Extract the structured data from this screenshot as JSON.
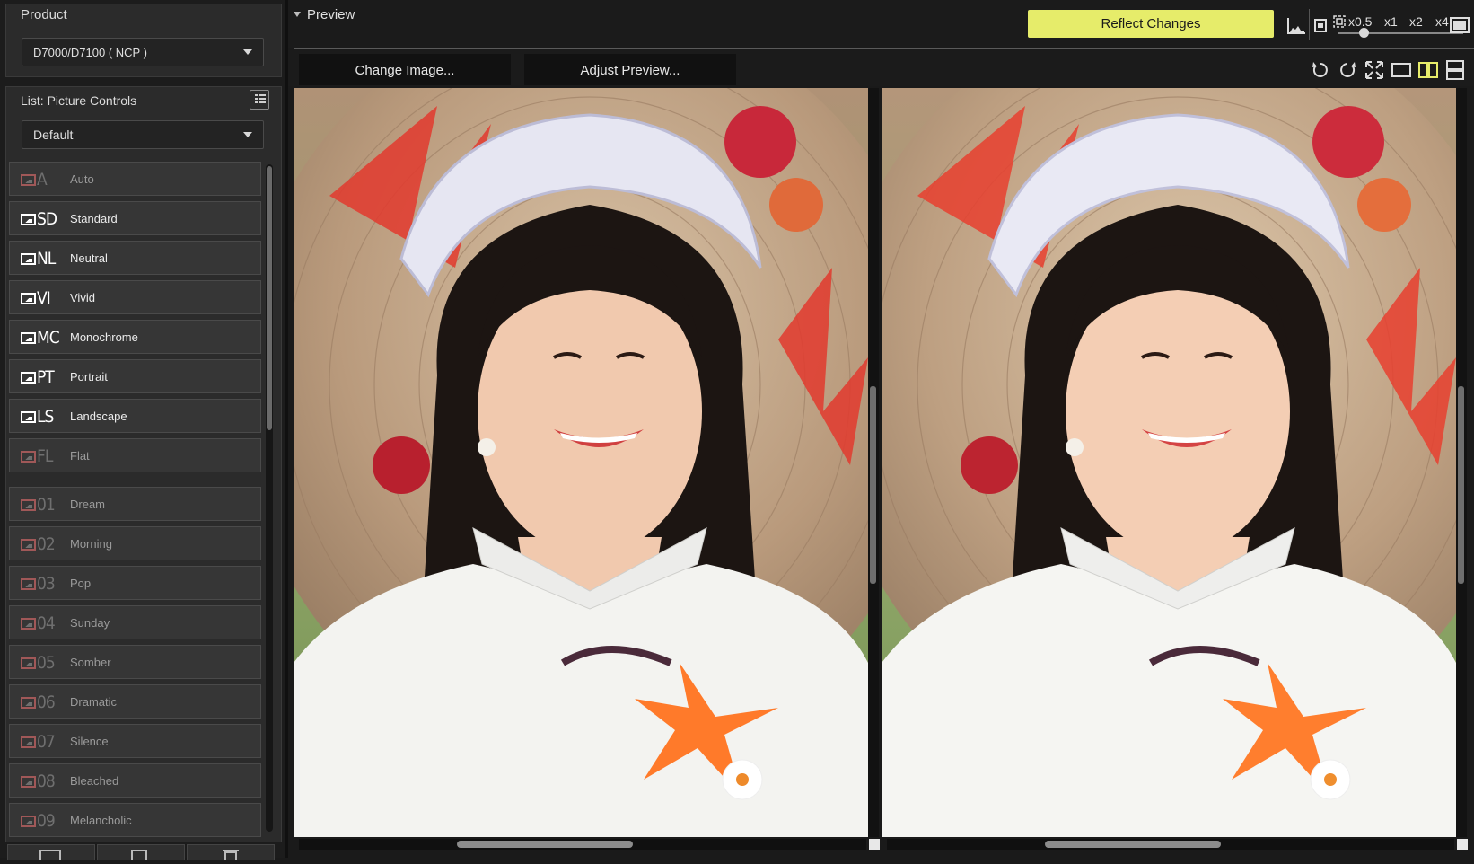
{
  "product": {
    "title": "Product",
    "selected": "D7000/D7100 ( NCP )"
  },
  "list": {
    "title": "List: Picture Controls",
    "selected": "Default"
  },
  "picture_controls": [
    {
      "code": "A",
      "label": "Auto",
      "dim": true
    },
    {
      "code": "SD",
      "label": "Standard",
      "dim": false
    },
    {
      "code": "NL",
      "label": "Neutral",
      "dim": false
    },
    {
      "code": "VI",
      "label": "Vivid",
      "dim": false
    },
    {
      "code": "MC",
      "label": "Monochrome",
      "dim": false
    },
    {
      "code": "PT",
      "label": "Portrait",
      "dim": false
    },
    {
      "code": "LS",
      "label": "Landscape",
      "dim": false
    },
    {
      "code": "FL",
      "label": "Flat",
      "dim": true
    },
    {
      "code": "01",
      "label": "Dream",
      "dim": true
    },
    {
      "code": "02",
      "label": "Morning",
      "dim": true
    },
    {
      "code": "03",
      "label": "Pop",
      "dim": true
    },
    {
      "code": "04",
      "label": "Sunday",
      "dim": true
    },
    {
      "code": "05",
      "label": "Somber",
      "dim": true
    },
    {
      "code": "06",
      "label": "Dramatic",
      "dim": true
    },
    {
      "code": "07",
      "label": "Silence",
      "dim": true
    },
    {
      "code": "08",
      "label": "Bleached",
      "dim": true
    },
    {
      "code": "09",
      "label": "Melancholic",
      "dim": true
    }
  ],
  "preview": {
    "title": "Preview",
    "reflect_label": "Reflect Changes",
    "change_image_label": "Change Image...",
    "adjust_preview_label": "Adjust Preview...",
    "zoom_levels": [
      "x0.5",
      "x1",
      "x2",
      "x4"
    ]
  },
  "colors": {
    "accent": "#e6ec6a",
    "background": "#1a1a1a",
    "panel": "#2b2b2b"
  }
}
